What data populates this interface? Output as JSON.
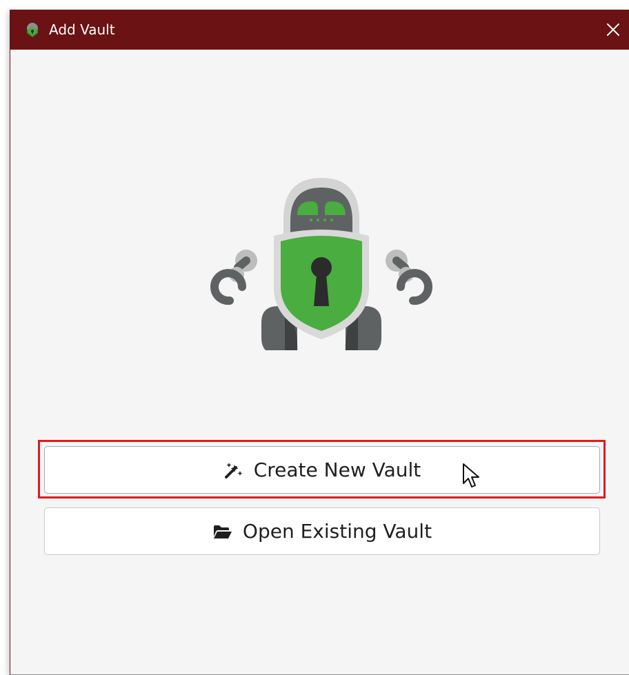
{
  "window": {
    "title": "Add Vault",
    "close_glyph": "✕"
  },
  "icons": {
    "app": "cryptomator-robot-icon",
    "close": "close-icon",
    "create": "magic-wand-icon",
    "open": "folder-open-icon"
  },
  "actions": {
    "create_label": "Create New Vault",
    "open_label": "Open Existing Vault"
  },
  "colors": {
    "titlebar": "#6a1214",
    "shield_green": "#49ad3f",
    "highlight_border": "#e0191f"
  }
}
